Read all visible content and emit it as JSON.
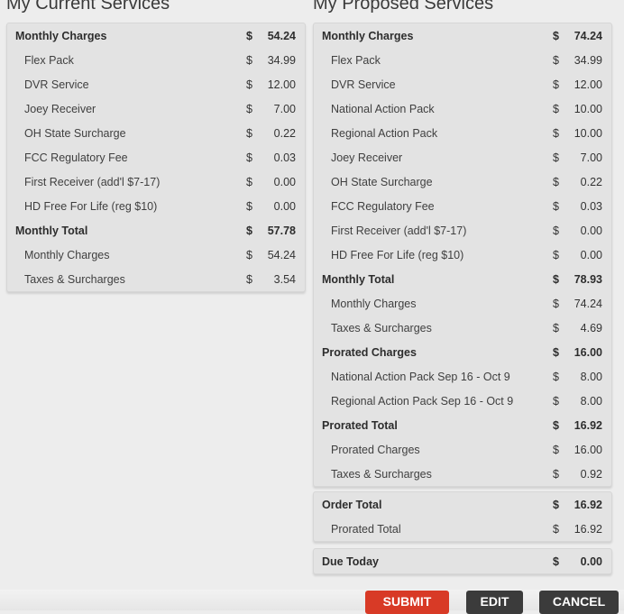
{
  "current": {
    "title": "My Current Services",
    "rows": [
      {
        "label": "Monthly Charges",
        "cur": "$",
        "amt": "54.24",
        "head": true
      },
      {
        "label": "Flex Pack",
        "cur": "$",
        "amt": "34.99"
      },
      {
        "label": "DVR Service",
        "cur": "$",
        "amt": "12.00"
      },
      {
        "label": "Joey Receiver",
        "cur": "$",
        "amt": "7.00"
      },
      {
        "label": "OH State Surcharge",
        "cur": "$",
        "amt": "0.22"
      },
      {
        "label": "FCC Regulatory Fee",
        "cur": "$",
        "amt": "0.03"
      },
      {
        "label": "First Receiver (add'l $7-17)",
        "cur": "$",
        "amt": "0.00"
      },
      {
        "label": "HD Free For Life (reg $10)",
        "cur": "$",
        "amt": "0.00"
      },
      {
        "label": "Monthly Total",
        "cur": "$",
        "amt": "57.78",
        "head": true
      },
      {
        "label": "Monthly Charges",
        "cur": "$",
        "amt": "54.24"
      },
      {
        "label": "Taxes & Surcharges",
        "cur": "$",
        "amt": "3.54"
      }
    ]
  },
  "proposed": {
    "title": "My Proposed Services",
    "rows": [
      {
        "label": "Monthly Charges",
        "cur": "$",
        "amt": "74.24",
        "head": true
      },
      {
        "label": "Flex Pack",
        "cur": "$",
        "amt": "34.99"
      },
      {
        "label": "DVR Service",
        "cur": "$",
        "amt": "12.00"
      },
      {
        "label": "National Action Pack",
        "cur": "$",
        "amt": "10.00"
      },
      {
        "label": "Regional Action Pack",
        "cur": "$",
        "amt": "10.00"
      },
      {
        "label": "Joey Receiver",
        "cur": "$",
        "amt": "7.00"
      },
      {
        "label": "OH State Surcharge",
        "cur": "$",
        "amt": "0.22"
      },
      {
        "label": "FCC Regulatory Fee",
        "cur": "$",
        "amt": "0.03"
      },
      {
        "label": "First Receiver (add'l $7-17)",
        "cur": "$",
        "amt": "0.00"
      },
      {
        "label": "HD Free For Life (reg $10)",
        "cur": "$",
        "amt": "0.00"
      },
      {
        "label": "Monthly Total",
        "cur": "$",
        "amt": "78.93",
        "head": true
      },
      {
        "label": "Monthly Charges",
        "cur": "$",
        "amt": "74.24"
      },
      {
        "label": "Taxes & Surcharges",
        "cur": "$",
        "amt": "4.69"
      },
      {
        "label": "Prorated Charges",
        "cur": "$",
        "amt": "16.00",
        "head": true
      },
      {
        "label": "National Action Pack Sep 16 - Oct 9",
        "cur": "$",
        "amt": "8.00"
      },
      {
        "label": "Regional Action Pack Sep 16 - Oct 9",
        "cur": "$",
        "amt": "8.00"
      },
      {
        "label": "Prorated Total",
        "cur": "$",
        "amt": "16.92",
        "head": true
      },
      {
        "label": "Prorated Charges",
        "cur": "$",
        "amt": "16.00"
      },
      {
        "label": "Taxes & Surcharges",
        "cur": "$",
        "amt": "0.92"
      }
    ]
  },
  "order": {
    "rows": [
      {
        "label": "Order Total",
        "cur": "$",
        "amt": "16.92",
        "head": true
      },
      {
        "label": "Prorated Total",
        "cur": "$",
        "amt": "16.92"
      }
    ]
  },
  "due": {
    "rows": [
      {
        "label": "Due Today",
        "cur": "$",
        "amt": "0.00",
        "head": true
      }
    ]
  },
  "buttons": {
    "submit": "SUBMIT",
    "edit": "EDIT",
    "cancel": "CANCEL"
  },
  "colors": {
    "submit": "#d83a26",
    "dark_button": "#3b3b3b",
    "panel": "#e3e3e3"
  }
}
